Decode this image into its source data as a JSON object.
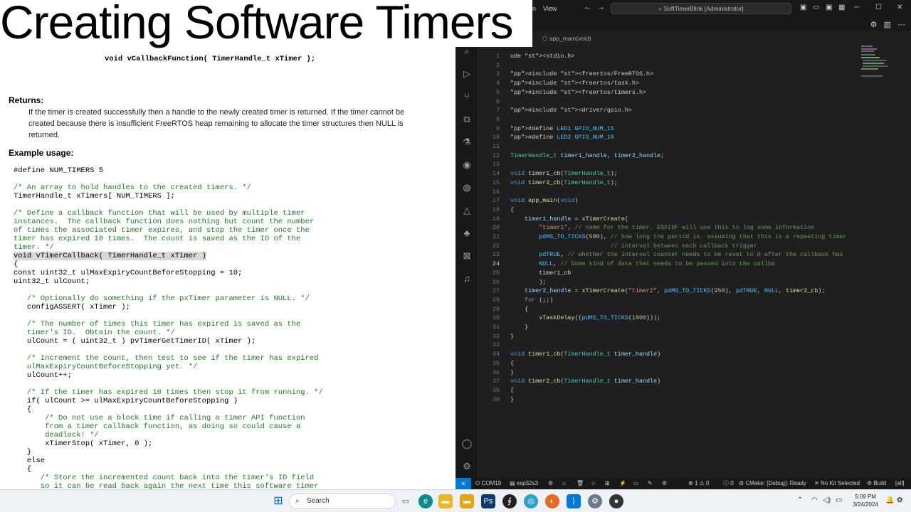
{
  "doc": {
    "title": "Creating Software Timers",
    "signature": "void vCallbackFunction( TimerHandle_t xTimer );",
    "returns_heading": "Returns:",
    "returns_text": "If the timer is created successfully then a handle to the newly created timer is returned. If the timer cannot be created because there is insufficient FreeRTOS heap remaining to allocate the timer structures then NULL is returned.",
    "example_heading": "Example usage:",
    "code_lines": [
      "#define NUM_TIMERS 5",
      "",
      "/* An array to hold handles to the created timers. */",
      "TimerHandle_t xTimers[ NUM_TIMERS ];",
      "",
      "/* Define a callback function that will be used by multiple timer",
      "instances.  The callback function does nothing but count the number",
      "of times the associated timer expires, and stop the timer once the",
      "timer has expired 10 times.  The count is saved as the ID of the",
      "timer. */",
      "void vTimerCallback( TimerHandle_t xTimer )",
      "{",
      "const uint32_t ulMaxExpiryCountBeforeStopping = 10;",
      "uint32_t ulCount;",
      "",
      "   /* Optionally do something if the pxTimer parameter is NULL. */",
      "   configASSERT( xTimer );",
      "",
      "   /* The number of times this timer has expired is saved as the",
      "   timer's ID.  Obtain the count. */",
      "   ulCount = ( uint32_t ) pvTimerGetTimerID( xTimer );",
      "",
      "   /* Increment the count, then test to see if the timer has expired",
      "   ulMaxExpiryCountBeforeStopping yet. */",
      "   ulCount++;",
      "",
      "   /* If the timer has expired 10 times then stop it from running. */",
      "   if( ulCount >= ulMaxExpiryCountBeforeStopping )",
      "   {",
      "       /* Do not use a block time if calling a timer API function",
      "       from a timer callback function, as doing so could cause a",
      "       deadlock! */",
      "       xTimerStop( xTimer, 0 );",
      "   }",
      "   else",
      "   {",
      "      /* Store the incremented count back into the timer's ID field",
      "      so it can be read back again the next time this software timer"
    ]
  },
  "vscode": {
    "menu": [
      "n",
      "View"
    ],
    "command_center": "SoftTimerBlink [Administrator]",
    "breadcrumb": "app_main(void)",
    "status": {
      "port": "COM19",
      "target": "esp32s3",
      "errors": "1",
      "warnings": "0",
      "problems": "0",
      "cmake": "CMake: [Debug]: Ready",
      "kit": "No Kit Selected",
      "build": "Build",
      "all": "[all]"
    },
    "code": [
      {
        "n": "1",
        "t": "ude <stdio.h>"
      },
      {
        "n": "2",
        "t": ""
      },
      {
        "n": "3",
        "t": "#include <freertos/FreeRTOS.h>"
      },
      {
        "n": "4",
        "t": "#include <freertos/task.h>"
      },
      {
        "n": "5",
        "t": "#include <freertos/timers.h>"
      },
      {
        "n": "6",
        "t": ""
      },
      {
        "n": "7",
        "t": "#include <driver/gpio.h>"
      },
      {
        "n": "8",
        "t": ""
      },
      {
        "n": "9",
        "t": "#define LED1 GPIO_NUM_15"
      },
      {
        "n": "10",
        "t": "#define LED2 GPIO_NUM_16"
      },
      {
        "n": "11",
        "t": ""
      },
      {
        "n": "12",
        "t": "TimerHandle_t timer1_handle, timer2_handle;"
      },
      {
        "n": "13",
        "t": ""
      },
      {
        "n": "14",
        "t": "void timer1_cb(TimerHandle_t);"
      },
      {
        "n": "15",
        "t": "void timer2_cb(TimerHandle_t);"
      },
      {
        "n": "16",
        "t": ""
      },
      {
        "n": "17",
        "t": "void app_main(void)"
      },
      {
        "n": "18",
        "t": "{"
      },
      {
        "n": "19",
        "t": "    timer1_handle = xTimerCreate("
      },
      {
        "n": "20",
        "t": "        \"timer1\", // name for the timer. ESPIDF will use this to log some information"
      },
      {
        "n": "21",
        "t": "        pdMS_TO_TICKS(500), // how long the period is. assuming that this is a repeating timer"
      },
      {
        "n": "22",
        "t": "                            // interval between each callback trigger"
      },
      {
        "n": "23",
        "t": "        pdTRUE, // whether the internal counter needs to be reset to 0 after the callback has"
      },
      {
        "n": "24",
        "t": "        NULL, // Some kind of data that needs to be passed into the callba"
      },
      {
        "n": "25",
        "t": "        timer1_cb"
      },
      {
        "n": "26",
        "t": "        );"
      },
      {
        "n": "27",
        "t": "    timer2_handle = xTimerCreate(\"timer2\", pdMS_TO_TICKS(250), pdTRUE, NULL, timer2_cb);"
      },
      {
        "n": "28",
        "t": "    for (;;)"
      },
      {
        "n": "29",
        "t": "    {"
      },
      {
        "n": "30",
        "t": "        vTaskDelay((pdMS_TO_TICKS(1000)));"
      },
      {
        "n": "31",
        "t": "    }"
      },
      {
        "n": "32",
        "t": "}"
      },
      {
        "n": "33",
        "t": ""
      },
      {
        "n": "34",
        "t": "void timer1_cb(TimerHandle_t timer_handle)"
      },
      {
        "n": "35",
        "t": "{"
      },
      {
        "n": "36",
        "t": "}"
      },
      {
        "n": "37",
        "t": "void timer2_cb(TimerHandle_t timer_handle)"
      },
      {
        "n": "38",
        "t": "{"
      },
      {
        "n": "39",
        "t": "}"
      }
    ],
    "current_line": "24"
  },
  "taskbar": {
    "search_placeholder": "Search",
    "time": "5:09 PM",
    "date": "3/24/2024",
    "apps": [
      "windows-start",
      "search",
      "file-explorer",
      "edge",
      "file-manager",
      "photoshop",
      "app-cursive",
      "app-badge",
      "firefox",
      "vscode",
      "settings",
      "app-red"
    ]
  }
}
